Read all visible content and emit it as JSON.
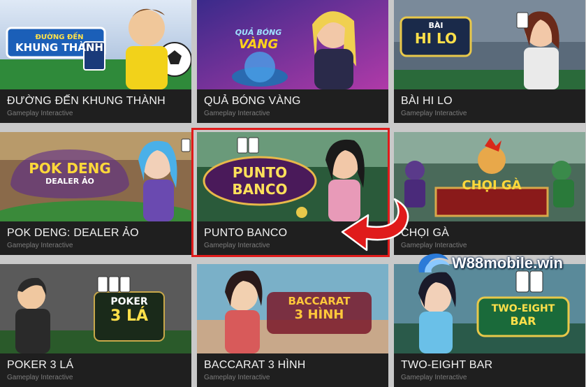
{
  "games": [
    {
      "title": "ĐƯỜNG ĐẾN KHUNG THÀNH",
      "provider": "Gameplay Interactive",
      "logo_top": "ĐƯỜNG ĐẾN",
      "logo_main": "KHUNG THÀNH",
      "accent": "#1e6ac8"
    },
    {
      "title": "QUẢ BÓNG VÀNG",
      "provider": "Gameplay Interactive",
      "logo_top": "QUẢ BÓNG",
      "logo_main": "VÀNG",
      "accent": "#5a1e9a"
    },
    {
      "title": "BÀI HI LO",
      "provider": "Gameplay Interactive",
      "logo_top": "BÀI",
      "logo_main": "HI LO",
      "accent": "#3a8a2a"
    },
    {
      "title": "POK DENG: DEALER ẢO",
      "provider": "Gameplay Interactive",
      "logo_top": "POK DENG",
      "logo_main": "DEALER ẢO",
      "accent": "#6a3a9e"
    },
    {
      "title": "PUNTO BANCO",
      "provider": "Gameplay Interactive",
      "logo_top": "PUNTO",
      "logo_main": "BANCO",
      "accent": "#2a7a3a"
    },
    {
      "title": "CHỌI GÀ",
      "provider": "Gameplay Interactive",
      "logo_top": "",
      "logo_main": "CHỌI GÀ",
      "accent": "#2a6a4a"
    },
    {
      "title": "POKER 3 LÁ",
      "provider": "Gameplay Interactive",
      "logo_top": "POKER",
      "logo_main": "3 LÁ",
      "accent": "#2a6a2a"
    },
    {
      "title": "BACCARAT 3 HÌNH",
      "provider": "Gameplay Interactive",
      "logo_top": "BACCARAT",
      "logo_main": "3 HÌNH",
      "accent": "#9a2a4a"
    },
    {
      "title": "TWO-EIGHT BAR",
      "provider": "Gameplay Interactive",
      "logo_top": "TWO-EIGHT",
      "logo_main": "BAR",
      "accent": "#2a5a9a"
    }
  ],
  "watermark": {
    "text": "W88mobile.win"
  },
  "colors": {
    "highlight": "#e01b1b",
    "card_bg": "#1e1e1e",
    "page_bg": "#c9c9c9"
  }
}
